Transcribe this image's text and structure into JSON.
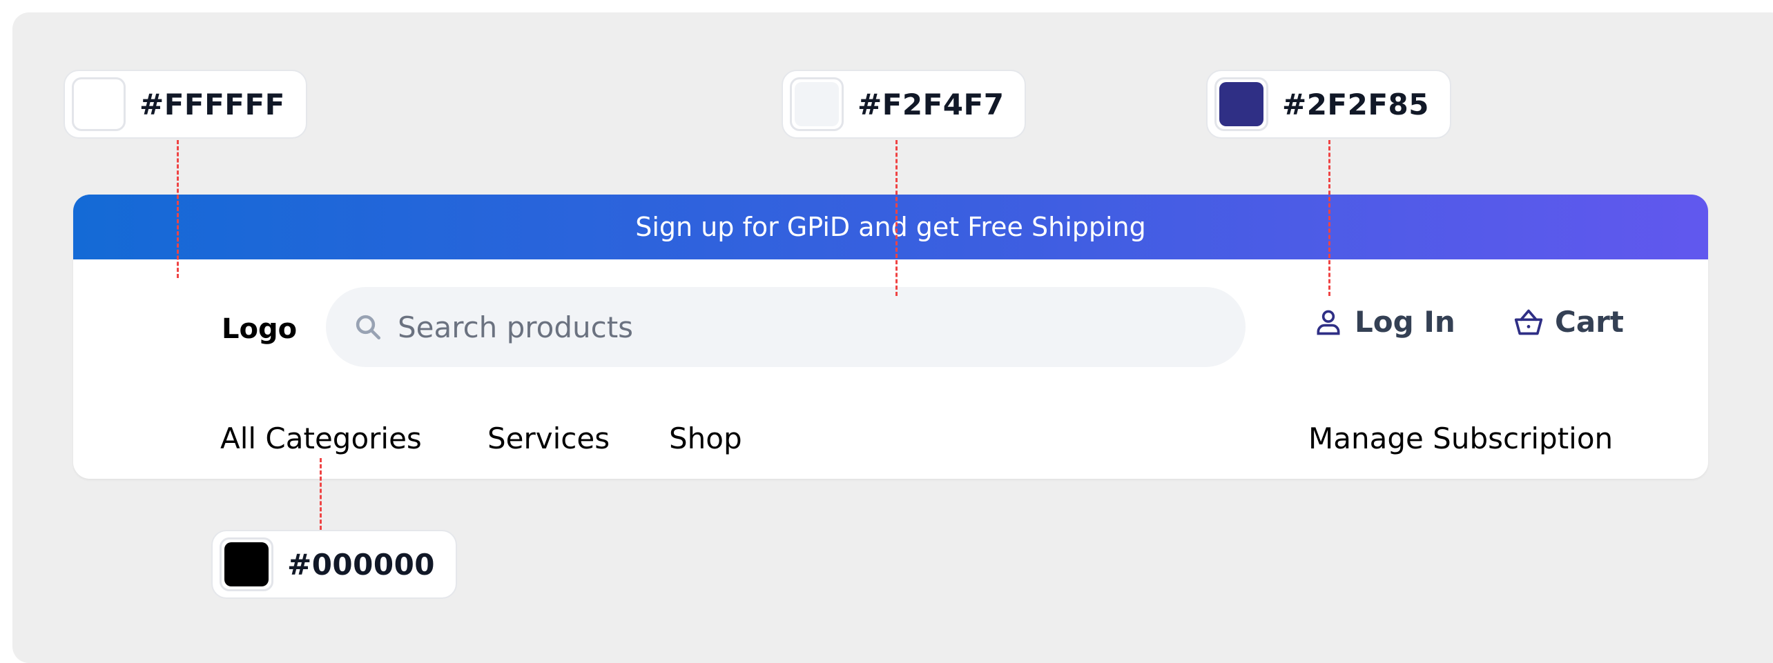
{
  "promo_banner": {
    "text": "Sign up for GPiD and get Free Shipping"
  },
  "header": {
    "logo": "Logo",
    "search": {
      "placeholder": "Search products",
      "value": ""
    },
    "login_label": "Log In",
    "cart_label": "Cart"
  },
  "nav": {
    "items": [
      {
        "label": "All Categories"
      },
      {
        "label": "Services"
      },
      {
        "label": "Shop"
      }
    ],
    "manage_subscription": "Manage Subscription"
  },
  "swatches": [
    {
      "hex": "#FFFFFF"
    },
    {
      "hex": "#F2F4F7"
    },
    {
      "hex": "#2F2F85"
    },
    {
      "hex": "#000000"
    }
  ],
  "icons": {
    "search": "search-icon",
    "login": "user-icon",
    "cart": "basket-icon"
  },
  "colors": {
    "white": "#FFFFFF",
    "search_bg": "#F2F4F7",
    "accent": "#2F2F85",
    "text": "#000000",
    "annotation_line": "#EF4444"
  }
}
